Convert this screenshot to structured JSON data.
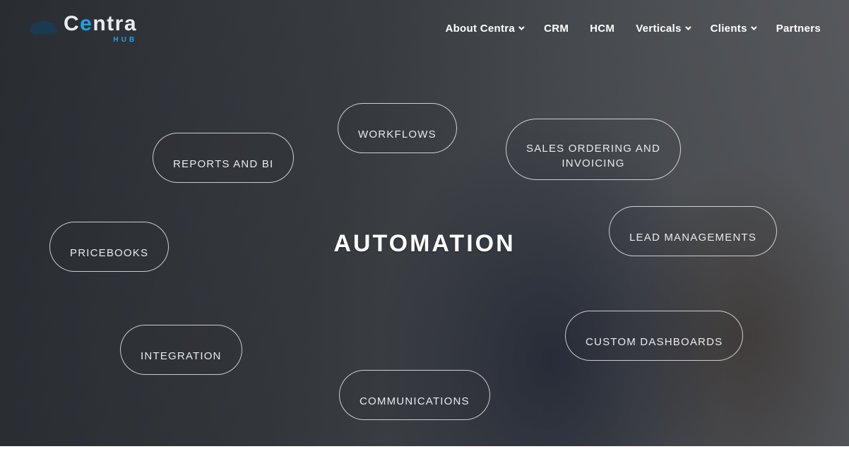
{
  "logo": {
    "main": "Centra",
    "sub": "HUB"
  },
  "nav": {
    "about": "About Centra",
    "crm": "CRM",
    "hcm": "HCM",
    "verticals": "Verticals",
    "clients": "Clients",
    "partners": "Partners"
  },
  "hero": {
    "title": "AUTOMATION"
  },
  "pills": {
    "workflows": "WORKFLOWS",
    "sales_ordering": "SALES ORDERING AND\nINVOICING",
    "reports_bi": "REPORTS AND BI",
    "pricebooks": "PRICEBOOKS",
    "lead_mgmt": "LEAD MANAGEMENTS",
    "integration": "INTEGRATION",
    "custom_dash": "CUSTOM DASHBOARDS",
    "communications": "COMMUNICATIONS"
  }
}
